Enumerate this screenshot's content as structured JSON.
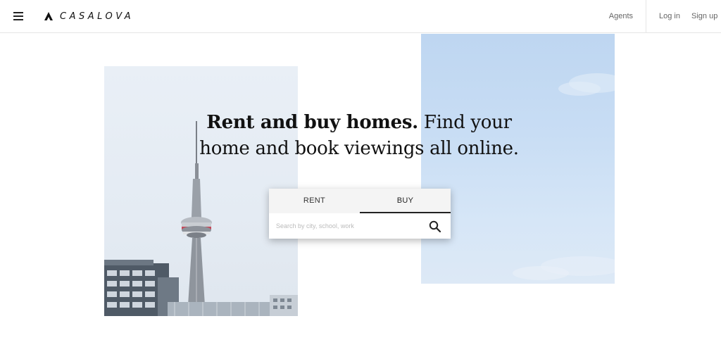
{
  "header": {
    "brand": "CASALOVA",
    "nav": {
      "agents": "Agents",
      "login": "Log in",
      "signup": "Sign up"
    }
  },
  "hero": {
    "headline_bold": "Rent and buy homes.",
    "headline_rest": " Find your home and book viewings all online."
  },
  "search": {
    "tabs": [
      "RENT",
      "BUY"
    ],
    "active_tab": "BUY",
    "placeholder": "Search by city, school, work"
  },
  "icons": {
    "menu": "menu-icon",
    "logo": "logo-tent-icon",
    "search": "search-icon"
  },
  "colors": {
    "text": "#111111",
    "sky": "#c8ddf4",
    "muted": "#666666"
  }
}
